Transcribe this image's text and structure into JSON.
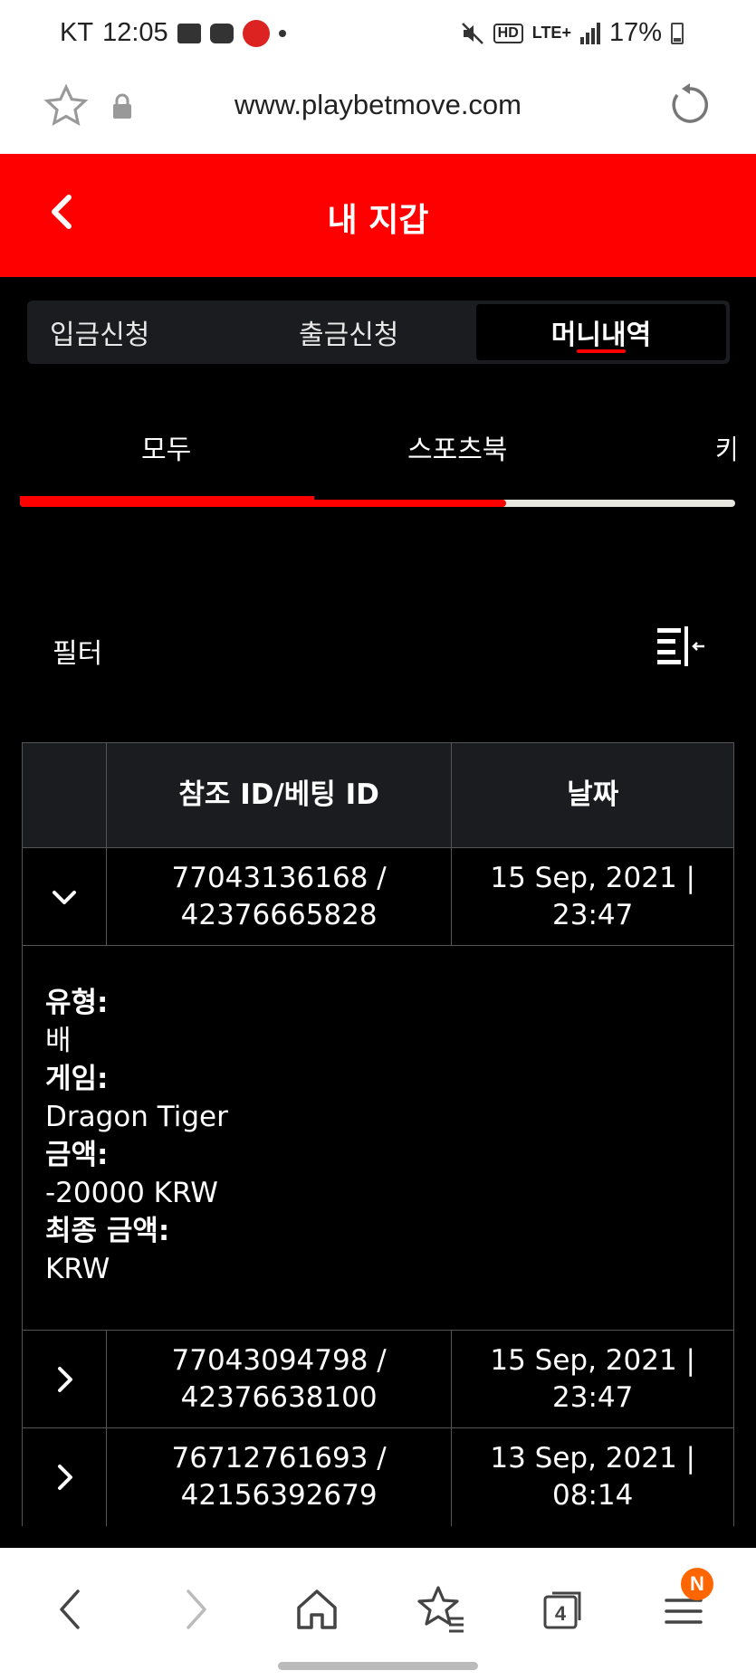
{
  "status_bar": {
    "carrier": "KT",
    "time": "12:05",
    "network": "LTE+",
    "hd": "HD",
    "battery": "17%"
  },
  "browser": {
    "url": "www.playbetmove.com",
    "tab_count": "4",
    "menu_badge": "N"
  },
  "header": {
    "title": "내 지갑"
  },
  "tabs": [
    {
      "label": "입금신청",
      "active": false
    },
    {
      "label": "출금신청",
      "active": false
    },
    {
      "label": "머니내역",
      "active": true
    }
  ],
  "subtabs": [
    {
      "label": "모두",
      "active": true
    },
    {
      "label": "스포츠북",
      "active": false
    },
    {
      "label": "카",
      "active": false
    }
  ],
  "scroll_progress": 0.68,
  "filter": {
    "label": "필터"
  },
  "table": {
    "headers": [
      "",
      "참조 ID/베팅 ID",
      "날짜"
    ],
    "rows": [
      {
        "ref_id": "77043136168 /",
        "bet_id": "42376665828",
        "date": "15 Sep, 2021 |",
        "time": "23:47",
        "expanded": true
      },
      {
        "ref_id": "77043094798 /",
        "bet_id": "42376638100",
        "date": "15 Sep, 2021 |",
        "time": "23:47",
        "expanded": false
      },
      {
        "ref_id": "76712761693 /",
        "bet_id": "42156392679",
        "date": "13 Sep, 2021 |",
        "time": "08:14",
        "expanded": false
      }
    ],
    "detail": {
      "type_label": "유형:",
      "type_value": "배",
      "game_label": "게임:",
      "game_value": "Dragon Tiger",
      "amount_label": "금액:",
      "amount_value": "-20000 KRW",
      "final_label": "최종 금액:",
      "final_value": "KRW"
    }
  },
  "colors": {
    "brand_red": "#ff0000",
    "panel": "#1b1c20",
    "badge_orange": "#ff6600"
  }
}
